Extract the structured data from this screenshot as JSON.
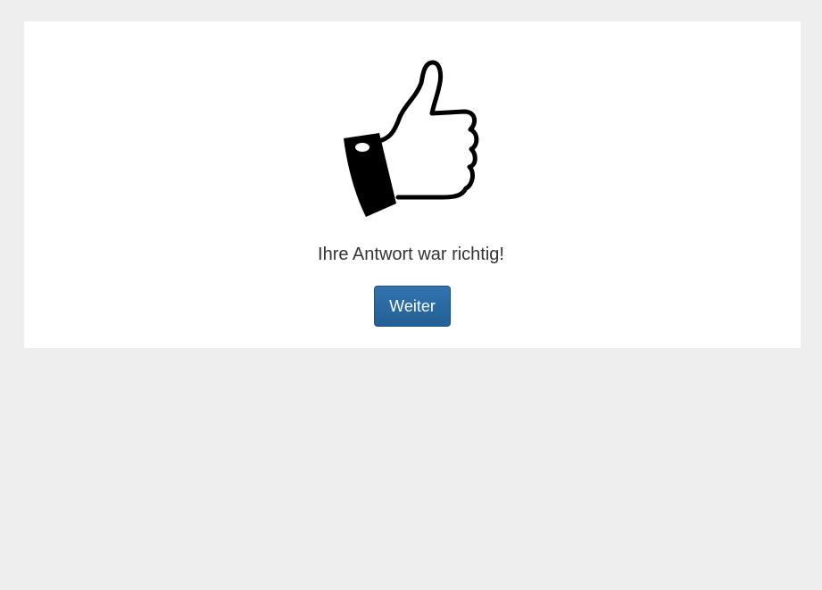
{
  "result": {
    "icon": "thumbs-up-icon",
    "message": "Ihre Antwort war richtig!",
    "next_button_label": "Weiter"
  },
  "colors": {
    "page_background": "#eeeeee",
    "card_background": "#ffffff",
    "button_primary": "#286090",
    "text": "#333333"
  }
}
